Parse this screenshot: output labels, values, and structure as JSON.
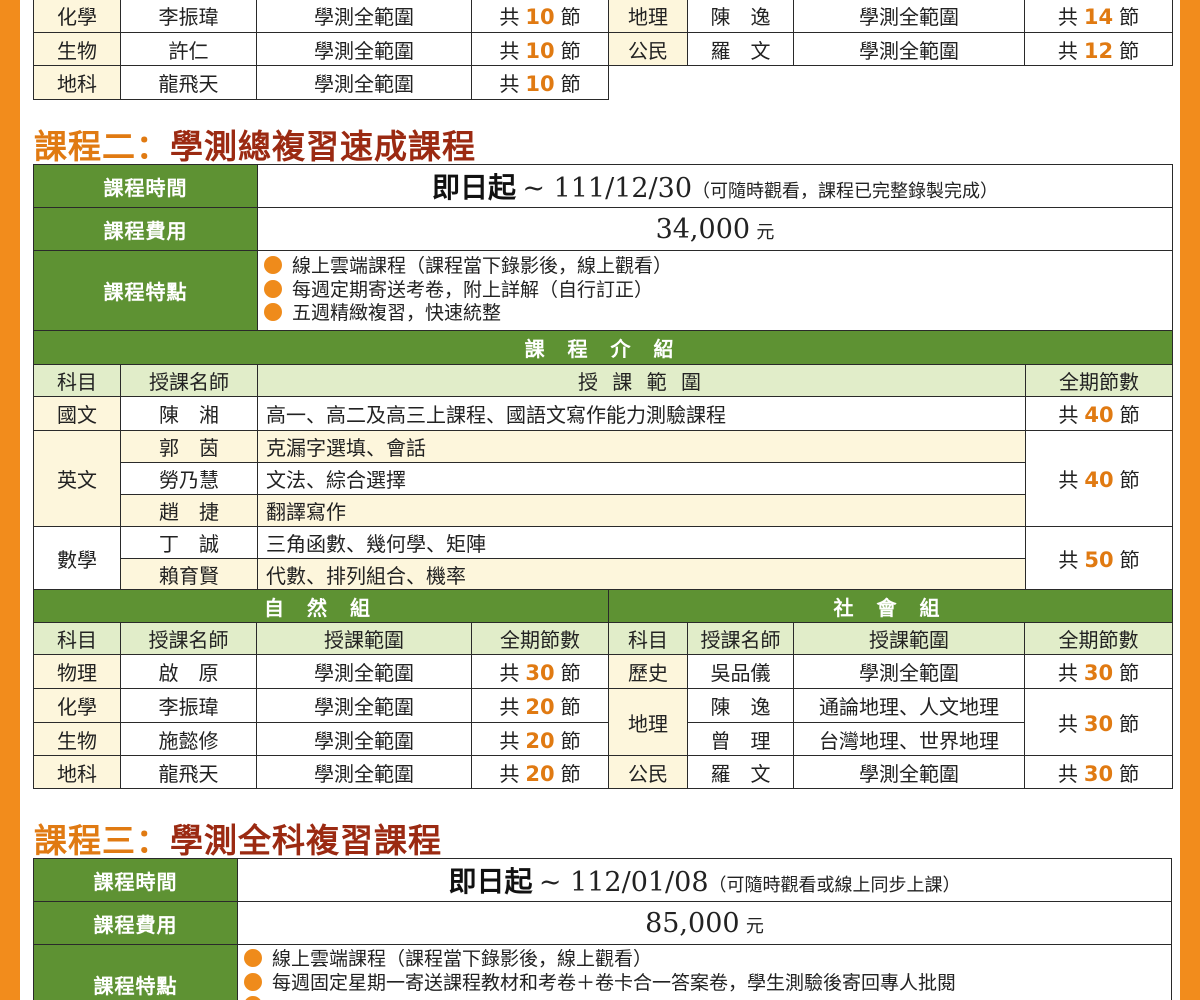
{
  "colors": {
    "frame": "#f28c1c",
    "green": "#5e9233",
    "light_green": "#e1edc9",
    "cream": "#fdf6dc",
    "orange": "#e07a12",
    "dark_red": "#9b2a12"
  },
  "top_left_rows": [
    {
      "subject": "化學",
      "teacher": "李振瑋",
      "range": "學測全範圍",
      "pre": "共",
      "count": "10",
      "post": "節"
    },
    {
      "subject": "生物",
      "teacher": "許仁",
      "range": "學測全範圍",
      "pre": "共",
      "count": "10",
      "post": "節"
    },
    {
      "subject": "地科",
      "teacher": "龍飛天",
      "range": "學測全範圍",
      "pre": "共",
      "count": "10",
      "post": "節"
    }
  ],
  "top_right_rows": [
    {
      "subject": "地理",
      "teacher": "陳　逸",
      "range": "學測全範圍",
      "pre": "共",
      "count": "14",
      "post": "節"
    },
    {
      "subject": "公民",
      "teacher": "羅　文",
      "range": "學測全範圍",
      "pre": "共",
      "count": "12",
      "post": "節"
    }
  ],
  "course2": {
    "title_prefix": "課程二：",
    "title_main": "學測總複習速成課程",
    "time_label": "課程時間",
    "time_start": "即日起",
    "time_end": "~ 111/12/30",
    "time_note": "（可隨時觀看，課程已完整錄製完成）",
    "fee_label": "課程費用",
    "fee_value": "34,000",
    "fee_unit": "元",
    "feature_label": "課程特點",
    "features": [
      "線上雲端課程（課程當下錄影後，線上觀看）",
      "每週定期寄送考卷，附上詳解（自行訂正）",
      "五週精緻複習，快速統整"
    ],
    "intro_header": "課 程 介 紹",
    "col_subject": "科目",
    "col_teacher": "授課名師",
    "col_range": "授 課 範 圍",
    "col_count": "全期節數",
    "chinese": {
      "subject": "國文",
      "teacher": "陳　湘",
      "range": "高一、高二及高三上課程、國語文寫作能力測驗課程",
      "pre": "共",
      "count": "40",
      "post": "節"
    },
    "english": {
      "subject": "英文",
      "rows": [
        {
          "teacher": "郭　茵",
          "range": "克漏字選填、會話"
        },
        {
          "teacher": "勞乃慧",
          "range": "文法、綜合選擇"
        },
        {
          "teacher": "趙　捷",
          "range": "翻譯寫作"
        }
      ],
      "pre": "共",
      "count": "40",
      "post": "節"
    },
    "math": {
      "subject": "數學",
      "rows": [
        {
          "teacher": "丁　誠",
          "range": "三角函數、幾何學、矩陣"
        },
        {
          "teacher": "賴育賢",
          "range": "代數、排列組合、機率"
        }
      ],
      "pre": "共",
      "count": "50",
      "post": "節"
    },
    "science": {
      "header": "自 然 組",
      "cols": {
        "subject": "科目",
        "teacher": "授課名師",
        "range": "授課範圍",
        "count": "全期節數"
      },
      "rows": [
        {
          "subject": "物理",
          "teacher": "啟　原",
          "range": "學測全範圍",
          "pre": "共",
          "count": "30",
          "post": "節"
        },
        {
          "subject": "化學",
          "teacher": "李振瑋",
          "range": "學測全範圍",
          "pre": "共",
          "count": "20",
          "post": "節"
        },
        {
          "subject": "生物",
          "teacher": "施懿修",
          "range": "學測全範圍",
          "pre": "共",
          "count": "20",
          "post": "節"
        },
        {
          "subject": "地科",
          "teacher": "龍飛天",
          "range": "學測全範圍",
          "pre": "共",
          "count": "20",
          "post": "節"
        }
      ]
    },
    "social": {
      "header": "社 會 組",
      "cols": {
        "subject": "科目",
        "teacher": "授課名師",
        "range": "授課範圍",
        "count": "全期節數"
      },
      "history": {
        "subject": "歷史",
        "teacher": "吳品儀",
        "range": "學測全範圍",
        "pre": "共",
        "count": "30",
        "post": "節"
      },
      "geography": {
        "subject": "地理",
        "rows": [
          {
            "teacher": "陳　逸",
            "range": "通論地理、人文地理"
          },
          {
            "teacher": "曾　理",
            "range": "台灣地理、世界地理"
          }
        ],
        "pre": "共",
        "count": "30",
        "post": "節"
      },
      "civics": {
        "subject": "公民",
        "teacher": "羅　文",
        "range": "學測全範圍",
        "pre": "共",
        "count": "30",
        "post": "節"
      }
    }
  },
  "course3": {
    "title_prefix": "課程三：",
    "title_main": "學測全科複習課程",
    "time_label": "課程時間",
    "time_start": "即日起",
    "time_end": "~ 112/01/08",
    "time_note": "（可隨時觀看或線上同步上課）",
    "fee_label": "課程費用",
    "fee_value": "85,000",
    "fee_unit": "元",
    "feature_label": "課程特點",
    "features": [
      "線上雲端課程（課程當下錄影後，線上觀看）",
      "每週固定星期一寄送課程教材和考卷＋卷卡合一答案卷，學生測驗後寄回專人批閱"
    ]
  }
}
